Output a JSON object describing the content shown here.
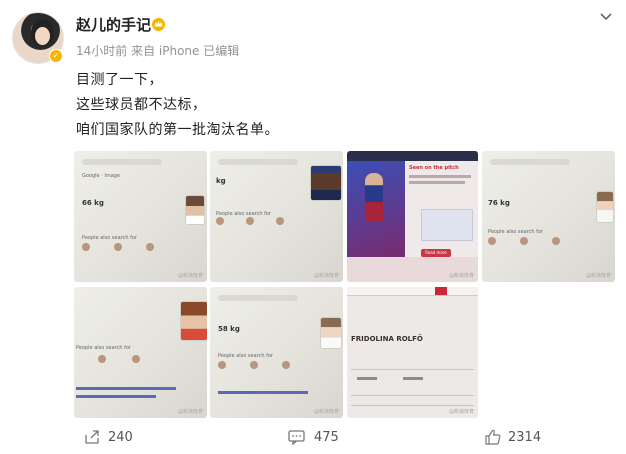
{
  "author": {
    "name": "赵儿的手记",
    "meta": "14小时前 来自 iPhone 已编辑"
  },
  "post": {
    "lines": [
      "目测了一下，",
      "这些球员都不达标，",
      "咱们国家队的第一批淘汰名单。"
    ]
  },
  "photos": [
    {
      "weight": "66 kg",
      "section": "People also search for",
      "watermark": "@新浪体育"
    },
    {
      "weight": "kg",
      "section": "People also search for",
      "watermark": "@新浪体育"
    },
    {
      "title": "Seen on the pitch",
      "button": "Read more",
      "watermark": "@新浪体育"
    },
    {
      "weight": "76 kg",
      "section": "People also search for",
      "watermark": "@新浪体育"
    },
    {
      "section": "People also search for",
      "watermark": "@新浪体育"
    },
    {
      "weight": "58 kg",
      "section": "People also search for",
      "watermark": "@新浪体育"
    },
    {
      "name": "FRIDOLINA ROLFÖ",
      "watermark": "@新浪体育"
    }
  ],
  "footer": {
    "shares": "240",
    "comments": "475",
    "likes": "2314"
  },
  "colors": {
    "accent": "#f7b500",
    "text": "#222222",
    "meta": "#939393"
  },
  "icons": [
    "crown-icon",
    "chevron-down-icon",
    "share-icon",
    "comment-icon",
    "like-icon"
  ]
}
